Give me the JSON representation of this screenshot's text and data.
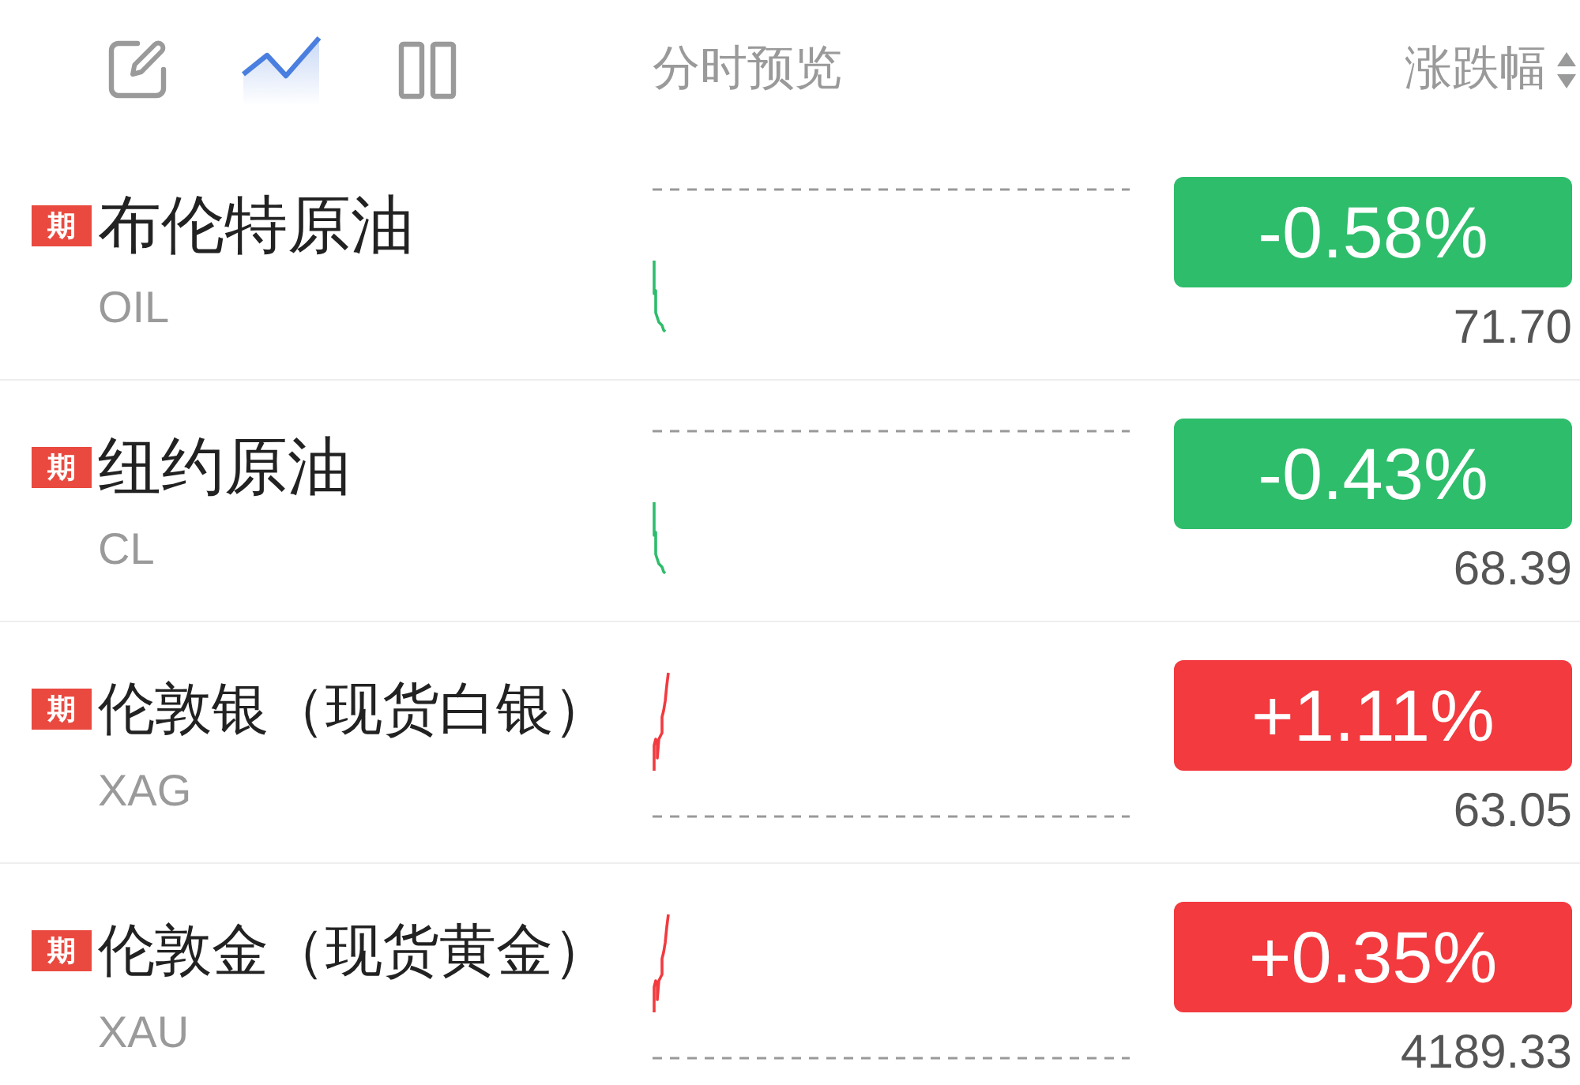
{
  "toolbar": [
    {
      "kind": "edit",
      "selected": false
    },
    {
      "kind": "chart",
      "selected": true
    },
    {
      "kind": "columns",
      "selected": false
    }
  ],
  "header": {
    "preview_label": "分时预览",
    "change_label": "涨跌幅"
  },
  "quotes": [
    {
      "badge": "期",
      "name": "布伦特原油",
      "code": "OIL",
      "kind": "fall",
      "color": "#2ebd6b",
      "change": "-0.58%",
      "price": "71.70"
    },
    {
      "badge": "期",
      "name": "纽约原油",
      "code": "CL",
      "kind": "fall",
      "color": "#2ebd6b",
      "change": "-0.43%",
      "price": "68.39"
    },
    {
      "badge": "期",
      "name": "伦敦银（现货白银）",
      "code": "XAG",
      "kind": "rise",
      "color": "#f23a3f",
      "change": "+1.11%",
      "price": "63.05"
    },
    {
      "badge": "期",
      "name": "伦敦金（现货黄金）",
      "code": "XAU",
      "kind": "rise",
      "color": "#f23a3f",
      "change": "+0.35%",
      "price": "4189.33"
    }
  ]
}
